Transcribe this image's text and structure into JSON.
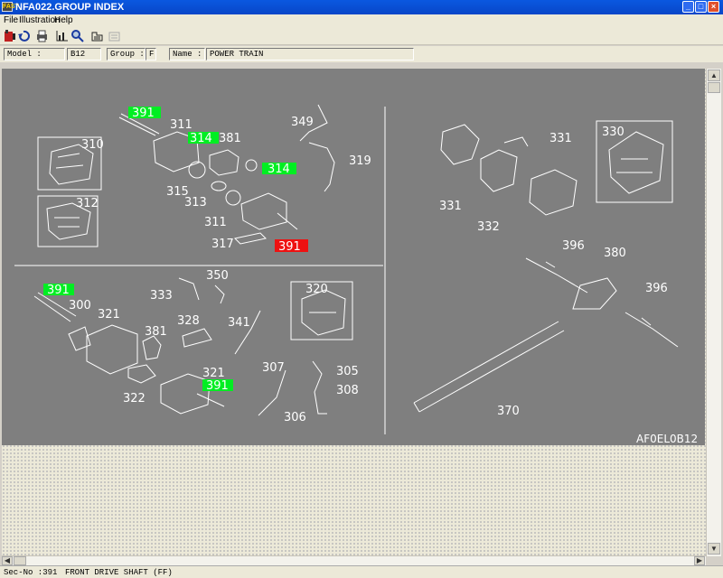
{
  "window": {
    "title": "NFA022.GROUP INDEX",
    "app_icon": "FAST"
  },
  "menu": {
    "file": "File",
    "illustration": "Illustration",
    "help": "Help"
  },
  "toolbar": {
    "icons": [
      "exit-icon",
      "back-icon",
      "print-icon",
      "graph-icon",
      "find-icon",
      "tab-icon",
      "disabled-icon"
    ]
  },
  "info": {
    "model_label": "Model :",
    "model_value": "B12",
    "group_label": "Group :",
    "group_value": "F",
    "name_label": "Name :",
    "name_value": "POWER TRAIN"
  },
  "illustration": {
    "code": "AF0EL0B12",
    "callouts": {
      "c391a": "391",
      "c311a": "311",
      "c314a": "314",
      "c381a": "381",
      "c310": "310",
      "c312": "312",
      "c315": "315",
      "c313": "313",
      "c311b": "311",
      "c317": "317",
      "c391sel": "391",
      "c349": "349",
      "c319": "319",
      "c314b": "314",
      "c330": "330",
      "c331a": "331",
      "c331b": "331",
      "c332": "332",
      "c396a": "396",
      "c380": "380",
      "c396b": "396",
      "c370": "370",
      "c391c": "391",
      "c300": "300",
      "c321a": "321",
      "c350": "350",
      "c333": "333",
      "c328": "328",
      "c341": "341",
      "c320": "320",
      "c381b": "381",
      "c322": "322",
      "c321b": "321",
      "c391d": "391",
      "c307": "307",
      "c305": "305",
      "c308": "308",
      "c306": "306"
    },
    "highlight_color": "#00ee22",
    "selected_color": "#ee1111"
  },
  "status": {
    "sec_no": "Sec-No :391",
    "description": "FRONT DRIVE SHAFT (FF)"
  }
}
